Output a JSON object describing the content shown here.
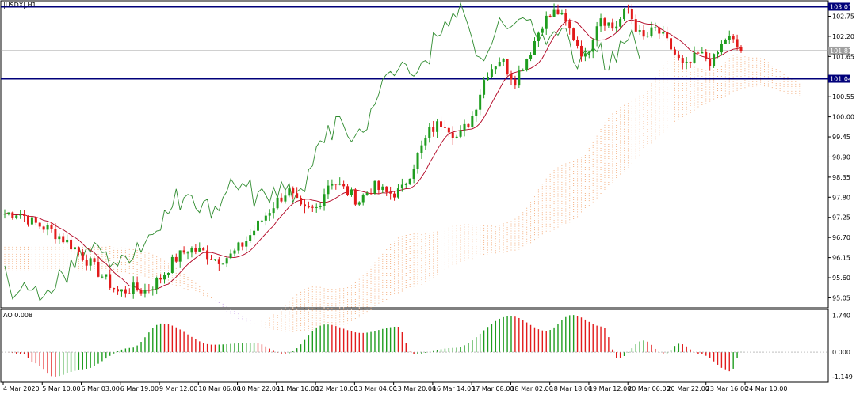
{
  "window": {
    "symbol_tf": "|USDX|,H1"
  },
  "colors": {
    "bull": "#1f9d1f",
    "bear": "#e21b1b",
    "chikou": "#2e8b2e",
    "kijun": "#b00020",
    "cloud_up": "#f4b183",
    "cloud_down": "#c8a6e8",
    "hline": "#00007a",
    "current": "#a0a0a0"
  },
  "chart_data": {
    "type": "candlestick",
    "title": "|USDX|,H1",
    "ylim": [
      94.8,
      103.15
    ],
    "ticks_y": [
      "102.75",
      "102.20",
      "101.65",
      "100.55",
      "100.00",
      "99.45",
      "98.90",
      "98.35",
      "97.80",
      "97.25",
      "96.70",
      "96.15",
      "95.60",
      "95.05"
    ],
    "ticks_x": [
      "4 Mar 2020",
      "5 Mar 10:00",
      "6 Mar 03:00",
      "6 Mar 19:00",
      "9 Mar 12:00",
      "10 Mar 06:00",
      "10 Mar 22:00",
      "11 Mar 16:00",
      "12 Mar 10:00",
      "13 Mar 04:00",
      "13 Mar 20:00",
      "16 Mar 14:00",
      "17 Mar 08:00",
      "18 Mar 02:00",
      "18 Mar 18:00",
      "19 Mar 12:00",
      "20 Mar 06:00",
      "20 Mar 22:00",
      "23 Mar 16:00",
      "24 Mar 10:00"
    ],
    "hlines": [
      {
        "value": 103.01,
        "label": "103.01"
      },
      {
        "value": 101.04,
        "label": "101.04"
      }
    ],
    "current_price": {
      "value": 101.81,
      "label": "101.81"
    },
    "close_path": [
      97.35,
      97.4,
      97.1,
      96.95,
      96.7,
      96.4,
      96.0,
      95.6,
      95.2,
      95.3,
      95.25,
      95.6,
      96.1,
      96.4,
      96.3,
      96.1,
      96.2,
      96.6,
      97.1,
      97.6,
      98.0,
      97.4,
      97.5,
      98.3,
      98.0,
      97.7,
      98.1,
      97.9,
      97.95,
      98.8,
      99.6,
      99.9,
      99.4,
      100.0,
      101.2,
      101.6,
      101.0,
      101.7,
      102.6,
      102.9,
      102.3,
      101.6,
      102.8,
      102.4,
      102.95,
      102.1,
      102.4,
      101.9,
      101.3,
      101.7,
      101.5,
      102.2,
      101.81
    ],
    "candle_count": 190,
    "oscillator": {
      "name": "AO",
      "value": "0.008",
      "ticks": [
        "1.740",
        "0.000",
        "-1.149"
      ],
      "ylim": [
        -1.3,
        1.9
      ],
      "waves": [
        [
          0.18,
          -0.1
        ],
        [
          0.1,
          -0.5
        ],
        [
          0.2,
          -1.15
        ],
        [
          0.25,
          -0.85
        ],
        [
          0.5,
          0.2
        ],
        [
          0.3,
          1.35
        ],
        [
          0.5,
          0.35
        ],
        [
          0.4,
          0.45
        ],
        [
          0.3,
          -0.1
        ],
        [
          0.4,
          1.3
        ],
        [
          0.35,
          0.9
        ],
        [
          0.35,
          1.2
        ],
        [
          0.15,
          -0.1
        ],
        [
          0.4,
          0.2
        ],
        [
          0.55,
          1.7
        ],
        [
          0.35,
          1.0
        ],
        [
          0.25,
          1.75
        ],
        [
          0.3,
          1.2
        ],
        [
          0.15,
          -0.3
        ],
        [
          0.25,
          0.55
        ],
        [
          0.2,
          -0.1
        ],
        [
          0.15,
          0.4
        ],
        [
          0.2,
          -0.1
        ],
        [
          0.3,
          -0.9
        ],
        [
          0.1,
          0.008
        ]
      ]
    }
  }
}
